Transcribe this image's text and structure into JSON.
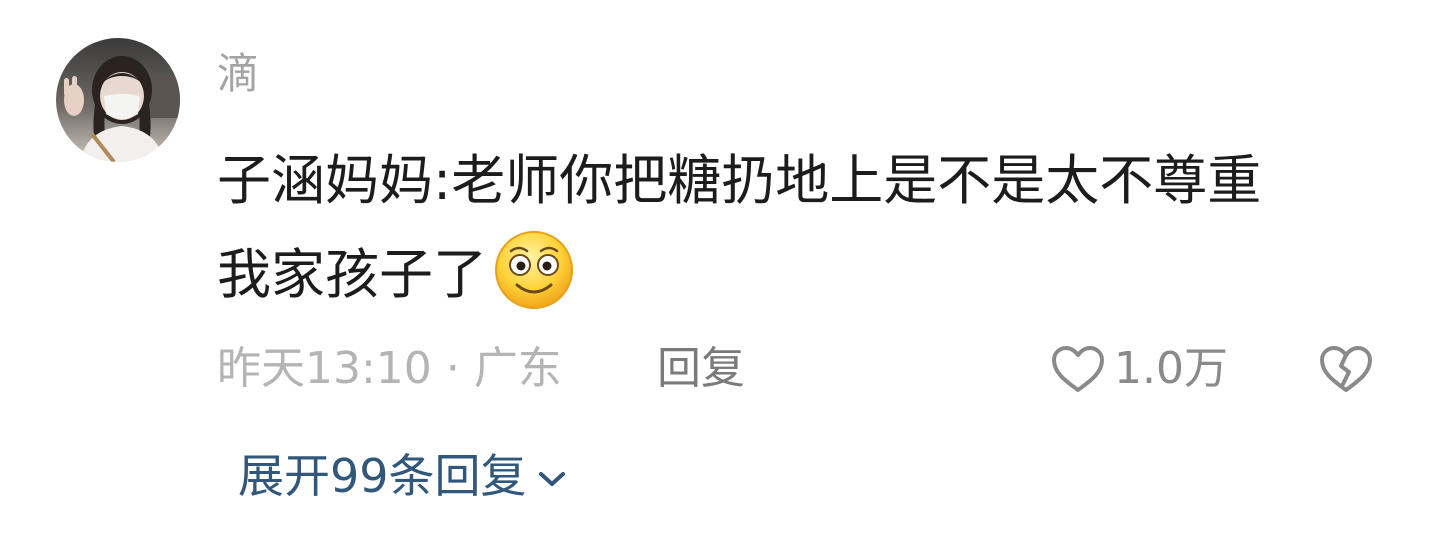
{
  "comment": {
    "username": "滴",
    "text_line1": "子涵妈妈:老师你把糖扔地上是不是太不尊重",
    "text_line2": "我家孩子了",
    "emoji": "smile-emoji",
    "time": "昨天13:10",
    "dot": "·",
    "location": "广东",
    "reply_label": "回复",
    "like_icon": "heart-outline-icon",
    "like_count": "1.0万",
    "dislike_icon": "broken-heart-icon",
    "expand_label": "展开99条回复",
    "expand_icon": "chevron-down-icon"
  },
  "colors": {
    "username": "#a4a4a4",
    "text": "#1c1c1c",
    "meta": "#b4b4b4",
    "reply": "#7a7a7a",
    "expand": "#31577a"
  }
}
